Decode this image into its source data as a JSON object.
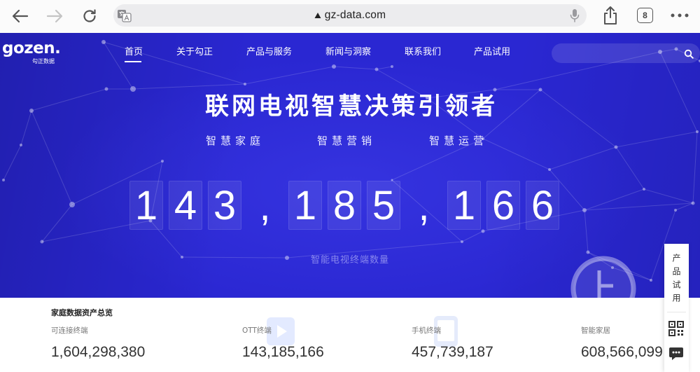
{
  "browser": {
    "url": "gz-data.com",
    "tab_count": "8",
    "forward_enabled": false,
    "icons": {
      "back": "back-arrow-icon",
      "forward": "forward-arrow-icon",
      "reload": "reload-icon",
      "translate": "translate-icon",
      "security": "warning-triangle-icon",
      "microphone": "microphone-icon",
      "share": "share-icon",
      "more": "more-dots-icon"
    }
  },
  "site": {
    "header": {
      "logo": {
        "wordmark": "gozen.",
        "subtitle": "勾正数据"
      },
      "nav": [
        {
          "label": "首页",
          "active": true
        },
        {
          "label": "关于勾正",
          "active": false
        },
        {
          "label": "产品与服务",
          "active": false
        },
        {
          "label": "新闻与洞察",
          "active": false
        },
        {
          "label": "联系我们",
          "active": false
        },
        {
          "label": "产品试用",
          "active": false
        }
      ],
      "search": {
        "value": "",
        "icon": "search-icon"
      }
    },
    "hero": {
      "title": "联网电视智慧决策引领者",
      "taglines": [
        "智慧家庭",
        "智慧营销",
        "智慧运营"
      ],
      "counter": "143,185,166",
      "counter_label": "智能电视终端数量",
      "back_to_top_icon": "back-to-top-icon"
    },
    "assets": {
      "title": "家庭数据资产总览",
      "stats": [
        {
          "label": "可连接终端",
          "value": "1,604,298,380"
        },
        {
          "label": "OTT终端",
          "value": "143,185,166"
        },
        {
          "label": "手机终端",
          "value": "457,739,187"
        },
        {
          "label": "智能家居",
          "value": "608,566,099"
        }
      ]
    },
    "side_panel": {
      "trial_label": "产品试用",
      "icons": [
        "qr-code-icon",
        "chat-icon"
      ]
    }
  },
  "colors": {
    "browser_bar": "#fbfbfb",
    "hero_background": "#2a27d2",
    "panel_background": "#ffffff",
    "stat_value": "#333333"
  }
}
